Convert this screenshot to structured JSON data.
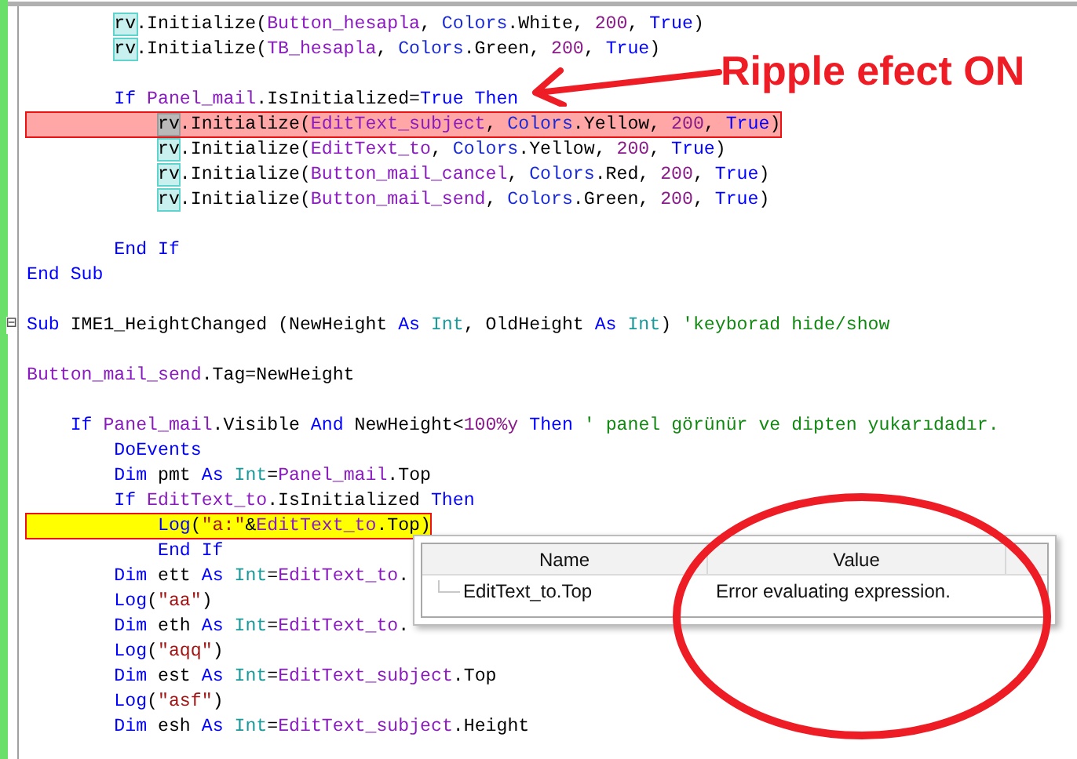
{
  "code_lines": [
    {
      "breakpoint": false,
      "current": false,
      "tokens": [
        {
          "kind": "ref",
          "t": "        rv"
        },
        {
          "kind": "plain",
          "t": ".Initialize("
        },
        {
          "kind": "id",
          "t": "Button_hesapla"
        },
        {
          "kind": "plain",
          "t": ", "
        },
        {
          "kind": "cls",
          "t": "Colors"
        },
        {
          "kind": "plain",
          "t": ".White, "
        },
        {
          "kind": "num",
          "t": "200"
        },
        {
          "kind": "plain",
          "t": ", "
        },
        {
          "kind": "kw",
          "t": "True"
        },
        {
          "kind": "plain",
          "t": ")"
        }
      ]
    },
    {
      "breakpoint": false,
      "current": false,
      "tokens": [
        {
          "kind": "ref",
          "t": "        rv"
        },
        {
          "kind": "plain",
          "t": ".Initialize("
        },
        {
          "kind": "id",
          "t": "TB_hesapla"
        },
        {
          "kind": "plain",
          "t": ", "
        },
        {
          "kind": "cls",
          "t": "Colors"
        },
        {
          "kind": "plain",
          "t": ".Green, "
        },
        {
          "kind": "num",
          "t": "200"
        },
        {
          "kind": "plain",
          "t": ", "
        },
        {
          "kind": "kw",
          "t": "True"
        },
        {
          "kind": "plain",
          "t": ")"
        }
      ]
    },
    {
      "breakpoint": false,
      "current": false
    },
    {
      "breakpoint": false,
      "current": false,
      "tokens": [
        {
          "kind": "kw",
          "t": "        If "
        },
        {
          "kind": "id",
          "t": "Panel_mail"
        },
        {
          "kind": "plain",
          "t": ".IsInitialized="
        },
        {
          "kind": "kw",
          "t": "True Then"
        }
      ]
    },
    {
      "breakpoint": true,
      "current": false,
      "tokens": [
        {
          "kind": "ref_active",
          "t": "            rv"
        },
        {
          "kind": "plain",
          "t": ".Initialize("
        },
        {
          "kind": "id",
          "t": "EditText_subject"
        },
        {
          "kind": "plain",
          "t": ", "
        },
        {
          "kind": "cls",
          "t": "Colors"
        },
        {
          "kind": "plain",
          "t": ".Yellow, "
        },
        {
          "kind": "num",
          "t": "200"
        },
        {
          "kind": "plain",
          "t": ", "
        },
        {
          "kind": "kw",
          "t": "True"
        },
        {
          "kind": "plain",
          "t": ")"
        }
      ]
    },
    {
      "breakpoint": false,
      "current": false,
      "tokens": [
        {
          "kind": "ref",
          "t": "            rv"
        },
        {
          "kind": "plain",
          "t": ".Initialize("
        },
        {
          "kind": "id",
          "t": "EditText_to"
        },
        {
          "kind": "plain",
          "t": ", "
        },
        {
          "kind": "cls",
          "t": "Colors"
        },
        {
          "kind": "plain",
          "t": ".Yellow, "
        },
        {
          "kind": "num",
          "t": "200"
        },
        {
          "kind": "plain",
          "t": ", "
        },
        {
          "kind": "kw",
          "t": "True"
        },
        {
          "kind": "plain",
          "t": ")"
        }
      ]
    },
    {
      "breakpoint": false,
      "current": false,
      "tokens": [
        {
          "kind": "ref",
          "t": "            rv"
        },
        {
          "kind": "plain",
          "t": ".Initialize("
        },
        {
          "kind": "id",
          "t": "Button_mail_cancel"
        },
        {
          "kind": "plain",
          "t": ", "
        },
        {
          "kind": "cls",
          "t": "Colors"
        },
        {
          "kind": "plain",
          "t": ".Red, "
        },
        {
          "kind": "num",
          "t": "200"
        },
        {
          "kind": "plain",
          "t": ", "
        },
        {
          "kind": "kw",
          "t": "True"
        },
        {
          "kind": "plain",
          "t": ")"
        }
      ]
    },
    {
      "breakpoint": false,
      "current": false,
      "tokens": [
        {
          "kind": "ref",
          "t": "            rv"
        },
        {
          "kind": "plain",
          "t": ".Initialize("
        },
        {
          "kind": "id",
          "t": "Button_mail_send"
        },
        {
          "kind": "plain",
          "t": ", "
        },
        {
          "kind": "cls",
          "t": "Colors"
        },
        {
          "kind": "plain",
          "t": ".Green, "
        },
        {
          "kind": "num",
          "t": "200"
        },
        {
          "kind": "plain",
          "t": ", "
        },
        {
          "kind": "kw",
          "t": "True"
        },
        {
          "kind": "plain",
          "t": ")"
        }
      ]
    },
    {
      "breakpoint": false,
      "current": false
    },
    {
      "breakpoint": false,
      "current": false,
      "tokens": [
        {
          "kind": "kw",
          "t": "        End If"
        }
      ]
    },
    {
      "breakpoint": false,
      "current": false,
      "tokens": [
        {
          "kind": "kw",
          "t": "End Sub"
        }
      ]
    },
    {
      "breakpoint": false,
      "current": false
    },
    {
      "breakpoint": false,
      "current": false,
      "fold": "⊟",
      "tokens": [
        {
          "kind": "kw",
          "t": "Sub "
        },
        {
          "kind": "plain",
          "t": "IME1_HeightChanged (NewHeight "
        },
        {
          "kind": "kw",
          "t": "As "
        },
        {
          "kind": "type",
          "t": "Int"
        },
        {
          "kind": "plain",
          "t": ", OldHeight "
        },
        {
          "kind": "kw",
          "t": "As "
        },
        {
          "kind": "type",
          "t": "Int"
        },
        {
          "kind": "plain",
          "t": ") "
        },
        {
          "kind": "comment",
          "t": "'keyborad hide/show"
        }
      ]
    },
    {
      "breakpoint": false,
      "current": false
    },
    {
      "breakpoint": false,
      "current": false,
      "tokens": [
        {
          "kind": "id",
          "t": "Button_mail_send"
        },
        {
          "kind": "plain",
          "t": ".Tag=NewHeight"
        }
      ]
    },
    {
      "breakpoint": false,
      "current": false
    },
    {
      "breakpoint": false,
      "current": false,
      "tokens": [
        {
          "kind": "kw",
          "t": "    If "
        },
        {
          "kind": "id",
          "t": "Panel_mail"
        },
        {
          "kind": "plain",
          "t": ".Visible "
        },
        {
          "kind": "kw",
          "t": "And "
        },
        {
          "kind": "plain",
          "t": "NewHeight<"
        },
        {
          "kind": "num",
          "t": "100%y"
        },
        {
          "kind": "kw",
          "t": " Then "
        },
        {
          "kind": "comment",
          "t": "' panel görünür ve dipten yukarıdadır."
        }
      ]
    },
    {
      "breakpoint": false,
      "current": false,
      "tokens": [
        {
          "kind": "kw",
          "t": "        DoEvents"
        }
      ]
    },
    {
      "breakpoint": false,
      "current": false,
      "tokens": [
        {
          "kind": "kw",
          "t": "        Dim "
        },
        {
          "kind": "plain",
          "t": "pmt "
        },
        {
          "kind": "kw",
          "t": "As "
        },
        {
          "kind": "type",
          "t": "Int"
        },
        {
          "kind": "plain",
          "t": "="
        },
        {
          "kind": "id",
          "t": "Panel_mail"
        },
        {
          "kind": "plain",
          "t": ".Top"
        }
      ]
    },
    {
      "breakpoint": false,
      "current": false,
      "tokens": [
        {
          "kind": "kw",
          "t": "        If "
        },
        {
          "kind": "id",
          "t": "EditText_to"
        },
        {
          "kind": "plain",
          "t": ".IsInitialized "
        },
        {
          "kind": "kw",
          "t": "Then"
        }
      ]
    },
    {
      "breakpoint": true,
      "current": true,
      "tokens": [
        {
          "kind": "kw",
          "t": "            Log"
        },
        {
          "kind": "plain",
          "t": "("
        },
        {
          "kind": "str",
          "t": "\"a:\""
        },
        {
          "kind": "plain",
          "t": "&"
        },
        {
          "kind": "id",
          "t": "EditText_to"
        },
        {
          "kind": "plain",
          "t": ".Top)"
        }
      ]
    },
    {
      "breakpoint": false,
      "current": false,
      "tokens": [
        {
          "kind": "kw",
          "t": "            End If"
        }
      ]
    },
    {
      "breakpoint": false,
      "current": false,
      "tokens": [
        {
          "kind": "kw",
          "t": "        Dim "
        },
        {
          "kind": "plain",
          "t": "ett "
        },
        {
          "kind": "kw",
          "t": "As "
        },
        {
          "kind": "type",
          "t": "Int"
        },
        {
          "kind": "plain",
          "t": "="
        },
        {
          "kind": "id",
          "t": "EditText_to"
        },
        {
          "kind": "plain",
          "t": "."
        }
      ]
    },
    {
      "breakpoint": false,
      "current": false,
      "tokens": [
        {
          "kind": "kw",
          "t": "        Log"
        },
        {
          "kind": "plain",
          "t": "("
        },
        {
          "kind": "str",
          "t": "\"aa\""
        },
        {
          "kind": "plain",
          "t": ")"
        }
      ]
    },
    {
      "breakpoint": false,
      "current": false,
      "tokens": [
        {
          "kind": "kw",
          "t": "        Dim "
        },
        {
          "kind": "plain",
          "t": "eth "
        },
        {
          "kind": "kw",
          "t": "As "
        },
        {
          "kind": "type",
          "t": "Int"
        },
        {
          "kind": "plain",
          "t": "="
        },
        {
          "kind": "id",
          "t": "EditText_to"
        },
        {
          "kind": "plain",
          "t": "."
        }
      ]
    },
    {
      "breakpoint": false,
      "current": false,
      "tokens": [
        {
          "kind": "kw",
          "t": "        Log"
        },
        {
          "kind": "plain",
          "t": "("
        },
        {
          "kind": "str",
          "t": "\"aqq\""
        },
        {
          "kind": "plain",
          "t": ")"
        }
      ]
    },
    {
      "breakpoint": false,
      "current": false,
      "tokens": [
        {
          "kind": "kw",
          "t": "        Dim "
        },
        {
          "kind": "plain",
          "t": "est "
        },
        {
          "kind": "kw",
          "t": "As "
        },
        {
          "kind": "type",
          "t": "Int"
        },
        {
          "kind": "plain",
          "t": "="
        },
        {
          "kind": "id",
          "t": "EditText_subject"
        },
        {
          "kind": "plain",
          "t": ".Top"
        }
      ]
    },
    {
      "breakpoint": false,
      "current": false,
      "tokens": [
        {
          "kind": "kw",
          "t": "        Log"
        },
        {
          "kind": "plain",
          "t": "("
        },
        {
          "kind": "str",
          "t": "\"asf\""
        },
        {
          "kind": "plain",
          "t": ")"
        }
      ]
    },
    {
      "breakpoint": false,
      "current": false,
      "tokens": [
        {
          "kind": "kw",
          "t": "        Dim "
        },
        {
          "kind": "plain",
          "t": "esh "
        },
        {
          "kind": "kw",
          "t": "As "
        },
        {
          "kind": "type",
          "t": "Int"
        },
        {
          "kind": "plain",
          "t": "="
        },
        {
          "kind": "id",
          "t": "EditText_subject"
        },
        {
          "kind": "plain",
          "t": ".Height"
        }
      ]
    }
  ],
  "annotation": {
    "text": "Ripple efect ON"
  },
  "watch_popup": {
    "columns": [
      "Name",
      "Value"
    ],
    "rows": [
      {
        "name": "EditText_to.Top",
        "value": "Error evaluating expression."
      }
    ]
  }
}
